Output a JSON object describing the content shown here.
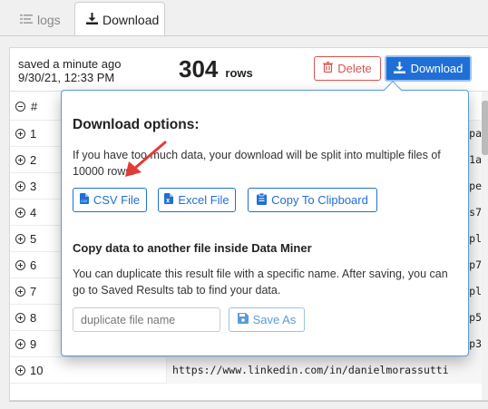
{
  "tabs": [
    {
      "label": "logs",
      "icon": "list-icon"
    },
    {
      "label": "Download",
      "icon": "download-icon",
      "active": true
    }
  ],
  "header": {
    "saved_line1": "saved a minute ago",
    "saved_line2": "9/30/21, 12:33 PM",
    "row_count": "304",
    "row_unit": "rows",
    "delete_label": "Delete",
    "download_label": "Download"
  },
  "table": {
    "header_label": "#",
    "rows": [
      {
        "index": "1",
        "value": "httpa"
      },
      {
        "index": "2",
        "value": "http1a"
      },
      {
        "index": "3",
        "value": "httpe"
      },
      {
        "index": "4",
        "value": "https7"
      },
      {
        "index": "5",
        "value": "httpl"
      },
      {
        "index": "6",
        "value": "http7"
      },
      {
        "index": "7",
        "value": "httpl"
      },
      {
        "index": "8",
        "value": "http5"
      },
      {
        "index": "9",
        "value": "http3"
      },
      {
        "index": "10",
        "value": "https://www.linkedin.com/in/danielmorassutti"
      }
    ]
  },
  "popover": {
    "title": "Download options:",
    "description": "If you have too much data, your download will be split into multiple files of 10000 rows.",
    "csv_label": "CSV File",
    "excel_label": "Excel File",
    "clipboard_label": "Copy To Clipboard",
    "copy_title": "Copy data to another file inside Data Miner",
    "copy_description": "You can duplicate this result file with a specific name. After saving, you can go to Saved Results tab to find your data.",
    "duplicate_placeholder": "duplicate file name",
    "save_as_label": "Save As"
  },
  "colors": {
    "primary": "#1f6fd6",
    "danger": "#d9534f",
    "annotation_arrow": "#e53935"
  }
}
